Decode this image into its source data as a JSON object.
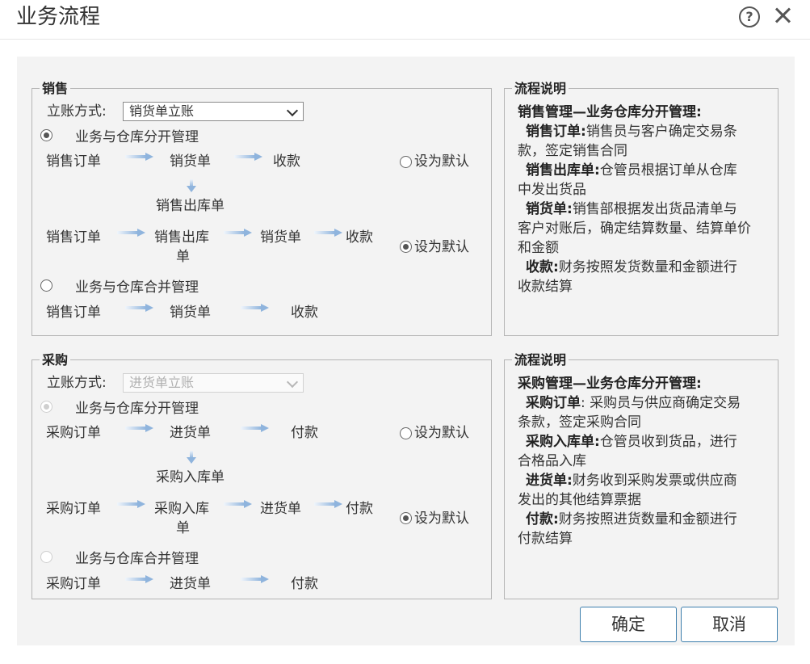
{
  "dialog": {
    "title": "业务流程"
  },
  "sales": {
    "legend": "销售",
    "account_label": "立账方式:",
    "account_value": "销货单立账",
    "option1_label": "业务与仓库分开管理",
    "option1_selected": true,
    "flow1": [
      "销售订单",
      "销货单",
      "收款"
    ],
    "flow1_down": "销售出库单",
    "flow1_default": "设为默认",
    "flow1_default_selected": false,
    "flow2_a": "销售订单",
    "flow2_b_line1": "销售出库",
    "flow2_b_line2": "单",
    "flow2_c": "销货单",
    "flow2_d": "收款",
    "flow2_default": "设为默认",
    "flow2_default_selected": true,
    "option2_label": "业务与仓库合并管理",
    "option2_selected": false,
    "flow3": [
      "销售订单",
      "销货单",
      "收款"
    ]
  },
  "sales_desc": {
    "legend": "流程说明",
    "heading": "销售管理—业务仓库分开管理:",
    "items": [
      {
        "term": "销售订单:",
        "line1": "销售员与客户确定交易条",
        "line2": "款，签定销售合同"
      },
      {
        "term": "销售出库单:",
        "line1": "仓管员根据订单从仓库",
        "line2": "中发出货品"
      },
      {
        "term": "销货单:",
        "line1": "销售部根据发出货品清单与",
        "line2": "客户对账后，确定结算数量、结算单价",
        "line3": "和金额"
      },
      {
        "term": "收款:",
        "line1": "财务按照发货数量和金额进行",
        "line2": "收款结算"
      }
    ]
  },
  "purchase": {
    "legend": "采购",
    "account_label": "立账方式:",
    "account_value": "进货单立账",
    "account_disabled": true,
    "option1_label": "业务与仓库分开管理",
    "option1_selected": true,
    "flow1": [
      "采购订单",
      "进货单",
      "付款"
    ],
    "flow1_down": "采购入库单",
    "flow1_default": "设为默认",
    "flow1_default_selected": false,
    "flow2_a": "采购订单",
    "flow2_b_line1": "采购入库",
    "flow2_b_line2": "单",
    "flow2_c": "进货单",
    "flow2_d": "付款",
    "flow2_default": "设为默认",
    "flow2_default_selected": true,
    "option2_label": "业务与仓库合并管理",
    "option2_selected": false,
    "flow3": [
      "采购订单",
      "进货单",
      "付款"
    ]
  },
  "purchase_desc": {
    "legend": "流程说明",
    "heading": "采购管理—业务仓库分开管理:",
    "items": [
      {
        "term": "采购订单",
        "line1": ": 采购员与供应商确定交易",
        "line2": "条款，签定采购合同"
      },
      {
        "term": "采购入库单:",
        "line1": "仓管员收到货品，进行",
        "line2": "合格品入库"
      },
      {
        "term": "进货单:",
        "line1": "财务收到采购发票或供应商",
        "line2": "发出的其他结算票据"
      },
      {
        "term": "付款:",
        "line1": "财务按照进货数量和金额进行",
        "line2": "付款结算"
      }
    ]
  },
  "buttons": {
    "ok": "确定",
    "cancel": "取消"
  }
}
